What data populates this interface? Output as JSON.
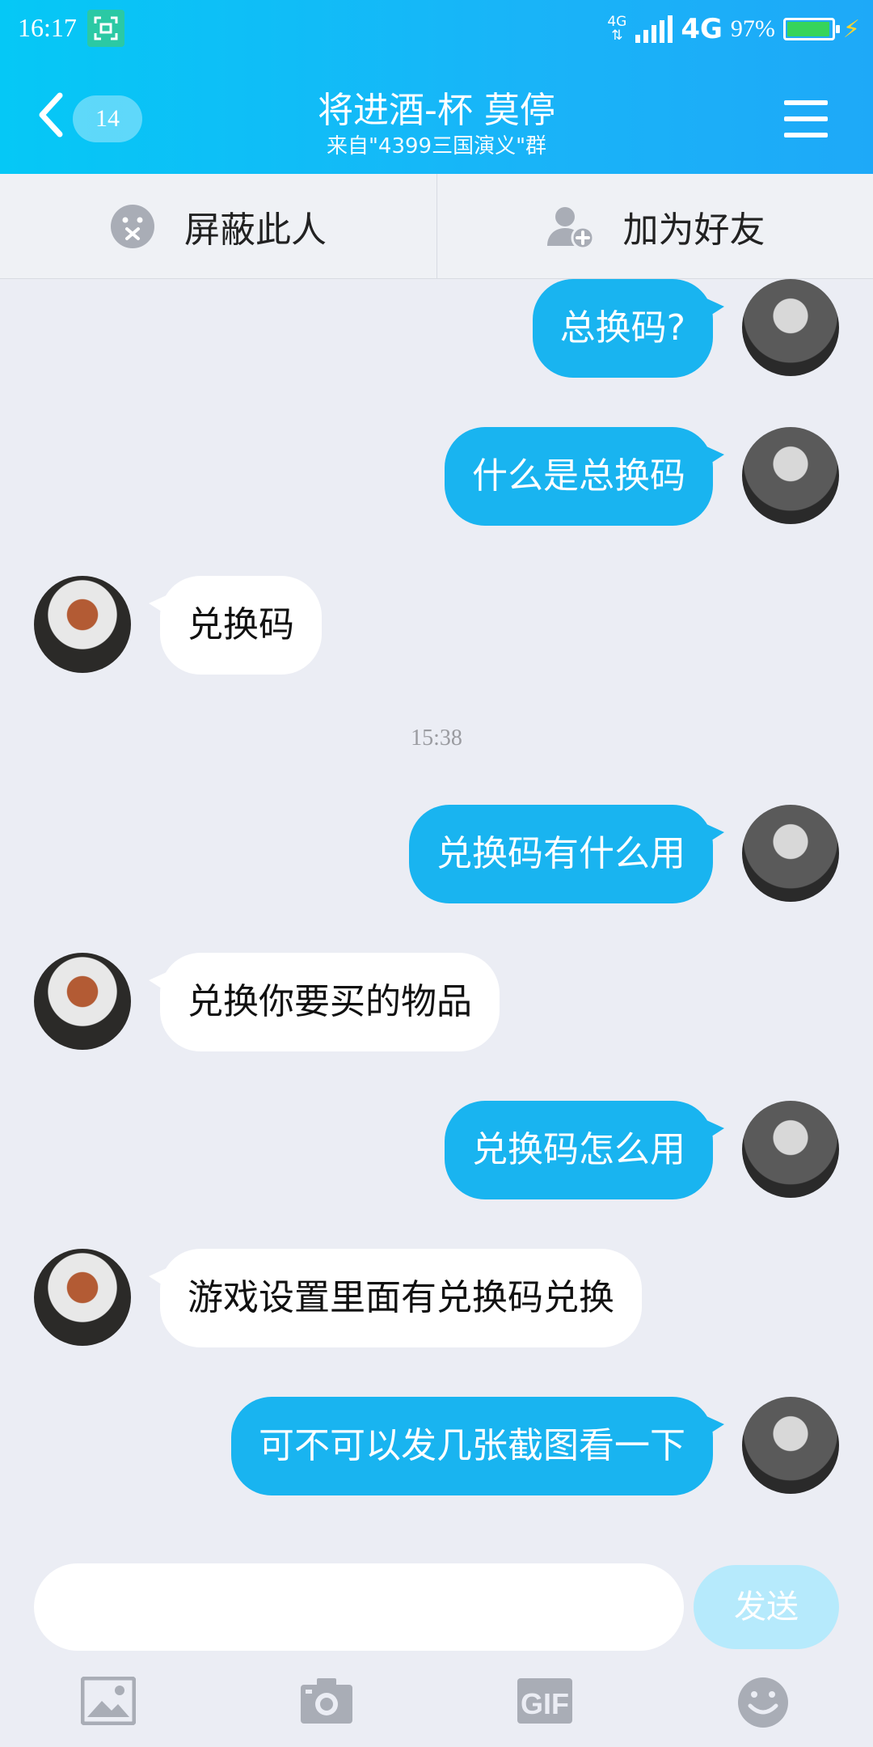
{
  "status": {
    "time": "16:17",
    "net_small": "4G",
    "net": "4G",
    "battery": "97%"
  },
  "header": {
    "badge": "14",
    "title": "将进酒-杯 莫停",
    "subtitle": "来自\"4399三国演义\"群"
  },
  "actions": {
    "block": "屏蔽此人",
    "add_friend": "加为好友"
  },
  "messages": [
    {
      "side": "out",
      "text": "总换码?"
    },
    {
      "side": "out",
      "text": "什么是总换码"
    },
    {
      "side": "in",
      "text": "兑换码"
    },
    {
      "side": "out",
      "text": "兑换码有什么用"
    },
    {
      "side": "in",
      "text": "兑换你要买的物品"
    },
    {
      "side": "out",
      "text": "兑换码怎么用"
    },
    {
      "side": "in",
      "text": "游戏设置里面有兑换码兑换"
    },
    {
      "side": "out",
      "text": "可不可以发几张截图看一下"
    }
  ],
  "timestamp": "15:38",
  "input": {
    "value": "",
    "send_label": "发送"
  },
  "tools": [
    "image-icon",
    "camera-icon",
    "gif-icon",
    "emoji-icon"
  ]
}
